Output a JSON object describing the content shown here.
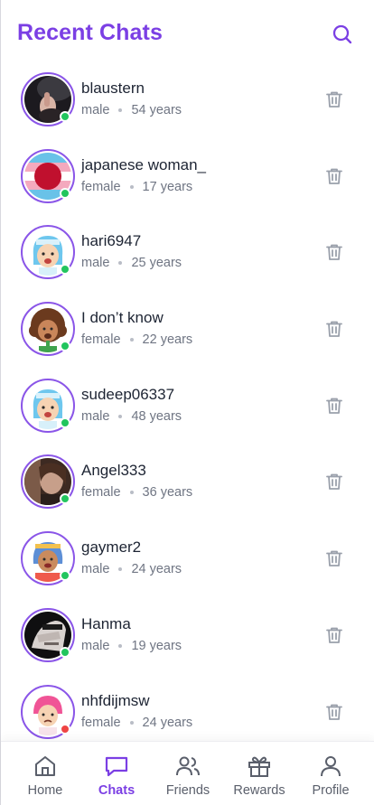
{
  "header": {
    "title": "Recent Chats",
    "search_icon": "search-icon"
  },
  "colors": {
    "accent": "#7b3fe4",
    "online": "#22c55e",
    "offline": "#ef4444"
  },
  "chats": [
    {
      "name": "blaustern",
      "gender": "male",
      "age": "54 years",
      "status": "online",
      "avatar": "photo-dark"
    },
    {
      "name": "japanese woman_",
      "gender": "female",
      "age": "17 years",
      "status": "online",
      "avatar": "flag-circle"
    },
    {
      "name": "hari6947",
      "gender": "male",
      "age": "25 years",
      "status": "online",
      "avatar": "cartoon-blue-hair"
    },
    {
      "name": "I don’t know",
      "gender": "female",
      "age": "22 years",
      "status": "online",
      "avatar": "cartoon-curly-hair"
    },
    {
      "name": "sudeep06337",
      "gender": "male",
      "age": "48 years",
      "status": "online",
      "avatar": "cartoon-blue-hair"
    },
    {
      "name": "Angel333",
      "gender": "female",
      "age": "36 years",
      "status": "online",
      "avatar": "photo-portrait"
    },
    {
      "name": "gaymer2",
      "gender": "male",
      "age": "24 years",
      "status": "online",
      "avatar": "cartoon-blue-braids"
    },
    {
      "name": "Hanma",
      "gender": "male",
      "age": "19 years",
      "status": "online",
      "avatar": "photo-bw"
    },
    {
      "name": "nhfdijmsw",
      "gender": "female",
      "age": "24 years",
      "status": "offline",
      "avatar": "cartoon-pink-hair"
    }
  ],
  "nav": {
    "items": [
      {
        "label": "Home",
        "icon": "home-icon",
        "active": false
      },
      {
        "label": "Chats",
        "icon": "chat-bubble-icon",
        "active": true
      },
      {
        "label": "Friends",
        "icon": "friends-icon",
        "active": false
      },
      {
        "label": "Rewards",
        "icon": "gift-icon",
        "active": false
      },
      {
        "label": "Profile",
        "icon": "profile-icon",
        "active": false
      }
    ]
  }
}
